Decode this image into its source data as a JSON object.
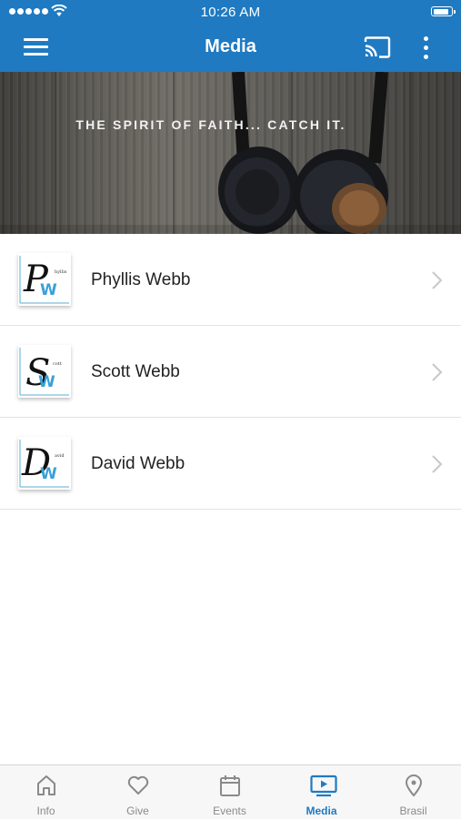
{
  "status_bar": {
    "time": "10:26 AM",
    "battery_level": 0.9
  },
  "header": {
    "title": "Media",
    "menu_icon": "hamburger-menu-icon",
    "cast_icon": "cast-icon",
    "more_icon": "more-vertical-icon",
    "color": "#1f7ac1"
  },
  "banner": {
    "tagline": "THE SPIRIT OF FAITH... CATCH IT."
  },
  "list": {
    "items": [
      {
        "label": "Phyllis Webb",
        "logo_letter": "P",
        "logo_small_text": "hyllis",
        "icon": "chevron-right-icon"
      },
      {
        "label": "Scott Webb",
        "logo_letter": "S",
        "logo_small_text": "cott",
        "icon": "chevron-right-icon"
      },
      {
        "label": "David Webb",
        "logo_letter": "D",
        "logo_small_text": "avid",
        "icon": "chevron-right-icon"
      }
    ]
  },
  "tabbar": {
    "tabs": [
      {
        "label": "Info",
        "icon": "home-icon",
        "active": false
      },
      {
        "label": "Give",
        "icon": "heart-icon",
        "active": false
      },
      {
        "label": "Events",
        "icon": "calendar-icon",
        "active": false
      },
      {
        "label": "Media",
        "icon": "play-screen-icon",
        "active": true
      },
      {
        "label": "Brasil",
        "icon": "location-pin-icon",
        "active": false
      }
    ],
    "active_color": "#1f7ac1",
    "inactive_color": "#8a8a8a"
  }
}
